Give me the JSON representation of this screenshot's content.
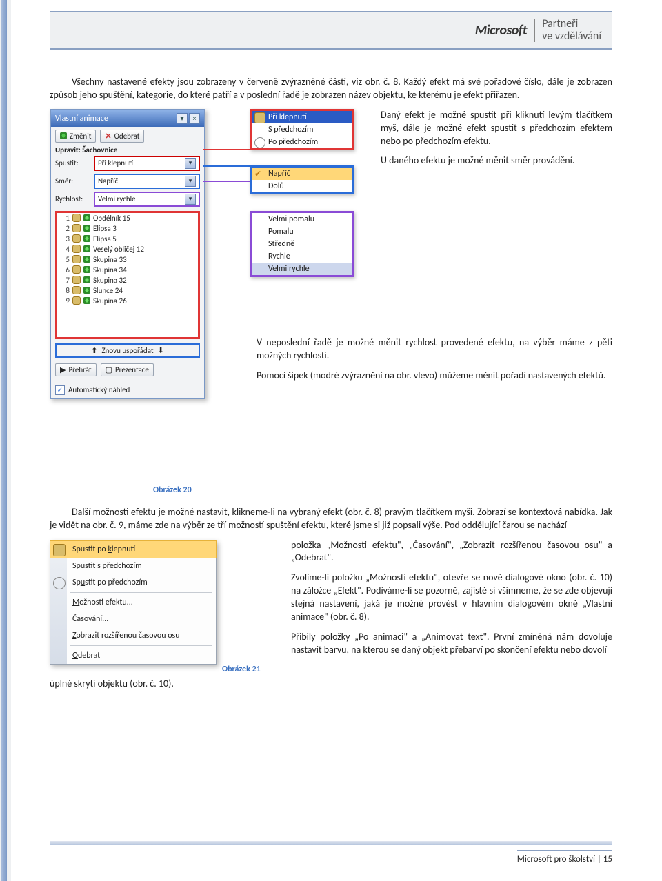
{
  "brand": {
    "ms": "Microsoft",
    "r1": "Partneři",
    "r2": "ve vzdělávání"
  },
  "para1": "Všechny nastavené efekty jsou zobrazeny v červeně zvýrazněné části, viz obr. č. 8. Každý efekt má své pořadové číslo, dále je zobrazen způsob jeho spuštění, kategorie, do které patří a v poslední řadě je zobrazen název objektu, ke kterému je efekt přiřazen.",
  "panel": {
    "title": "Vlastní animace",
    "btn_change": "Změnit",
    "btn_remove": "Odebrat",
    "upravit": "Upravit: Šachovnice",
    "row_spustit": "Spustit:",
    "sel_spustit": "Při klepnutí",
    "row_smer": "Směr:",
    "sel_smer": "Napříč",
    "row_rychlost": "Rychlost:",
    "sel_rychlost": "Velmi rychle",
    "items": [
      {
        "n": "1",
        "label": "Obdélník 15"
      },
      {
        "n": "2",
        "label": "Elipsa 3"
      },
      {
        "n": "3",
        "label": "Elipsa 5"
      },
      {
        "n": "4",
        "label": "Veselý obličej 12"
      },
      {
        "n": "5",
        "label": "Skupina 33"
      },
      {
        "n": "6",
        "label": "Skupina 34"
      },
      {
        "n": "7",
        "label": "Skupina 32"
      },
      {
        "n": "8",
        "label": "Slunce 24"
      },
      {
        "n": "9",
        "label": "Skupina 26"
      }
    ],
    "reorder": "Znovu uspořádat",
    "play": "Přehrát",
    "present": "Prezentace",
    "autoprev": "Automatický náhled"
  },
  "pop1": {
    "a": "Při klepnutí",
    "b": "S předchozím",
    "c": "Po předchozím"
  },
  "pop2": {
    "a": "Napříč",
    "b": "Dolů"
  },
  "pop3": {
    "a": "Velmi pomalu",
    "b": "Pomalu",
    "c": "Středně",
    "d": "Rychle",
    "e": "Velmi rychle"
  },
  "right1a": "Daný efekt je možné spustit při kliknutí levým tlačítkem myš, dále je možné efekt spustit s předchozím efektem nebo po předchozím efektu.",
  "right1b": "U daného efektu je možné měnit směr provádění.",
  "right2a": "V neposlední řadě je možné měnit rychlost provedené efektu, na výběr máme z pěti možných rychlostí.",
  "right2b": "Pomocí šipek (modré zvýraznění na obr. vlevo) můžeme měnit pořadí nastavených efektů.",
  "cap20": "Obrázek 20",
  "lower_p1": "Další možnosti efektu je možné nastavit, klikneme-li na vybraný efekt (obr. č. 8) pravým tlačítkem myši. Zobrazí se kontextová nabídka. Jak je vidět na obr. č. 9, máme zde na výběr ze tří možností spuštění efektu, které jsme si již popsali výše. Pod oddělující čarou se nachází",
  "lower_p1b": "položka „Možnosti efektu\", „Časování\", „Zobrazit rozšířenou časovou osu\" a „Odebrat\".",
  "lower_p2": "Zvolíme-li položku „Možnosti efektu\", otevře se nové dialogové okno (obr. č. 10) na záložce „Efekt\". Podíváme-li se pozorně, zajisté si všimneme, že se zde objevují stejná nastavení, jaká je možné provést v hlavním dialogovém okně „Vlastní animace\" (obr. č. 8).",
  "lower_p3": "Přibily položky „Po animaci\" a „Animovat text\". První zmíněná nám dovoluje nastavit barvu, na kterou se daný objekt přebarví po skončení efektu nebo dovolí",
  "lower_tail": "úplné skrytí objektu (obr. č. 10).",
  "ctx": {
    "a": "Spustit po klepnutí",
    "b": "Spustit s předchozím",
    "c": "Spustit po předchozím",
    "d": "Možnosti efektu...",
    "e": "Časování...",
    "f": "Zobrazit rozšířenou časovou osu",
    "g": "Odebrat"
  },
  "cap21": "Obrázek 21",
  "footer": "Microsoft pro školství | 15"
}
